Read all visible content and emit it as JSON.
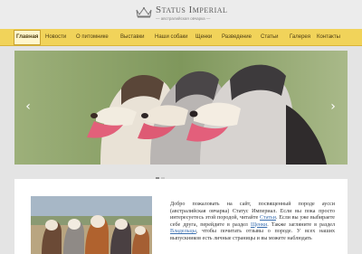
{
  "brand": {
    "title": "Status Imperial",
    "subtitle": "— австралийская овчарка —"
  },
  "nav": {
    "items": [
      {
        "label": "Главная",
        "active": true
      },
      {
        "label": "Новости"
      },
      {
        "label": "О питомнике"
      },
      {
        "label": "Выставки"
      },
      {
        "label": "Наши собаки"
      },
      {
        "label": "Щенки"
      },
      {
        "label": "Разведение"
      },
      {
        "label": "Статьи"
      },
      {
        "label": "Галерея"
      },
      {
        "label": "Контакты"
      }
    ]
  },
  "slider": {
    "prev_icon": "chevron-left-icon",
    "next_icon": "chevron-right-icon",
    "dots_total": 2,
    "active_dot": 1
  },
  "intro": {
    "p1": "Добро пожаловать на сайт, посвященный породе аусси (австралийская овчарка) Статус Империал. Если вы пока просто интересуетесь этой породой, читайте",
    "link_articles": "Статьи",
    "p2": ". Если вы уже выбираете себе друга, перейдите в раздел",
    "link_puppies": "Щенки",
    "p3": ". Также загляните в раздел",
    "link_dogs": "Владельцы",
    "p4": ", чтобы почитать отзывы о породе. У всех наших выпускников есть личные страницы и вы можете наблюдать"
  },
  "colors": {
    "nav_bg": "#f1d35a",
    "nav_active_bg": "#fff6cc",
    "link": "#3a6fb0",
    "page_bg": "#e4e4e4"
  }
}
